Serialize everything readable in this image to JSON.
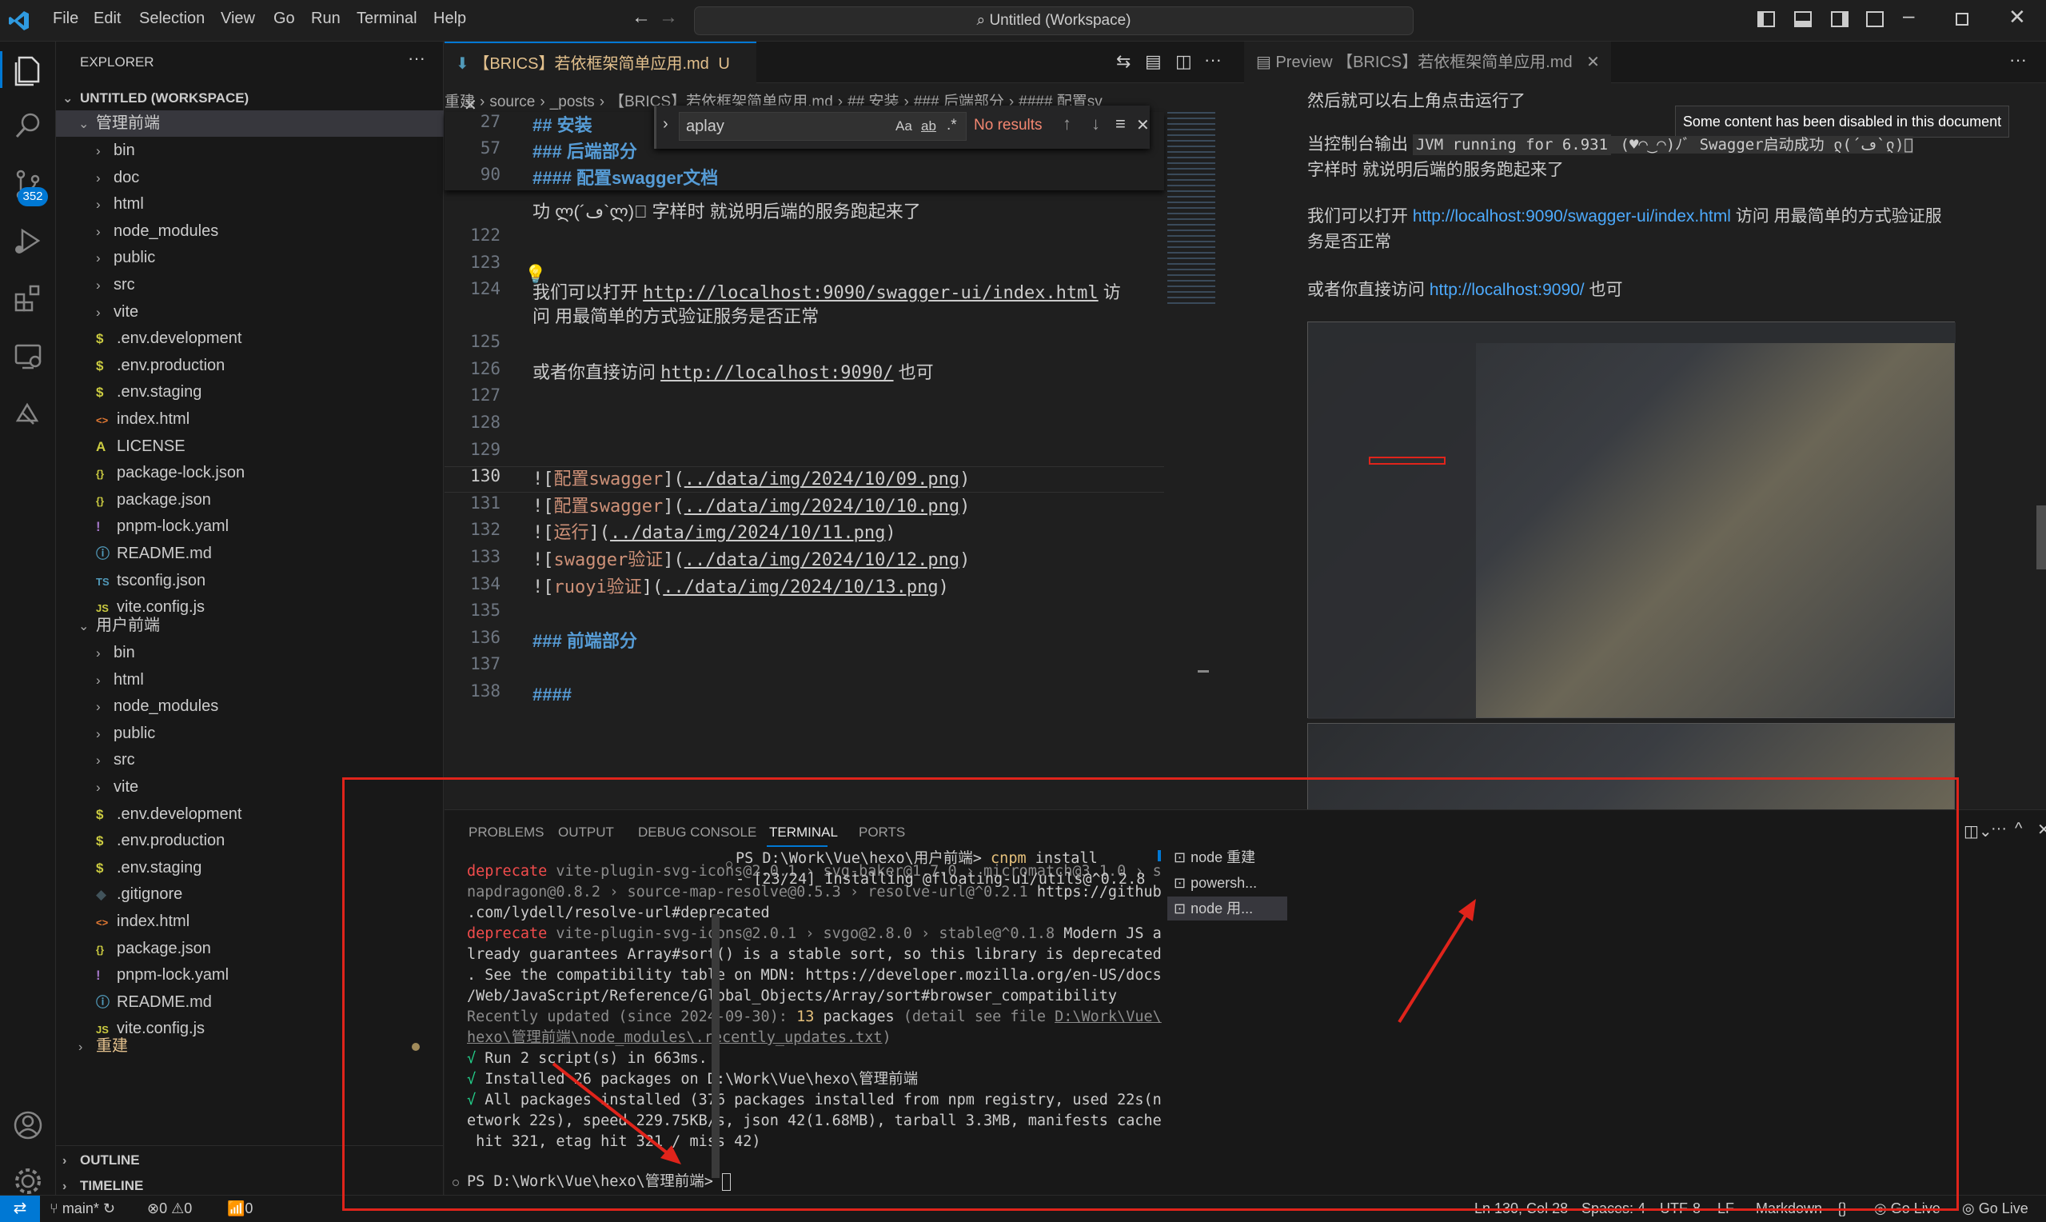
{
  "window": {
    "title": "Untitled (Workspace)",
    "menu": [
      "File",
      "Edit",
      "Selection",
      "View",
      "Go",
      "Run",
      "Terminal",
      "Help"
    ]
  },
  "activity": {
    "scm_badge": "352"
  },
  "explorer": {
    "header": "EXPLORER",
    "workspace": "UNTITLED (WORKSPACE)",
    "folder1": {
      "name": "管理前端",
      "items": [
        {
          "label": "bin",
          "kind": "folder"
        },
        {
          "label": "doc",
          "kind": "folder"
        },
        {
          "label": "html",
          "kind": "folder"
        },
        {
          "label": "node_modules",
          "kind": "folder"
        },
        {
          "label": "public",
          "kind": "folder"
        },
        {
          "label": "src",
          "kind": "folder"
        },
        {
          "label": "vite",
          "kind": "folder"
        },
        {
          "label": ".env.development",
          "kind": "env"
        },
        {
          "label": ".env.production",
          "kind": "env"
        },
        {
          "label": ".env.staging",
          "kind": "env"
        },
        {
          "label": "index.html",
          "kind": "html"
        },
        {
          "label": "LICENSE",
          "kind": "license"
        },
        {
          "label": "package-lock.json",
          "kind": "json"
        },
        {
          "label": "package.json",
          "kind": "json"
        },
        {
          "label": "pnpm-lock.yaml",
          "kind": "yaml"
        },
        {
          "label": "README.md",
          "kind": "info"
        },
        {
          "label": "tsconfig.json",
          "kind": "ts"
        },
        {
          "label": "vite.config.js",
          "kind": "js"
        }
      ]
    },
    "folder2": {
      "name": "用户前端",
      "items": [
        {
          "label": "bin",
          "kind": "folder"
        },
        {
          "label": "html",
          "kind": "folder"
        },
        {
          "label": "node_modules",
          "kind": "folder"
        },
        {
          "label": "public",
          "kind": "folder"
        },
        {
          "label": "src",
          "kind": "folder"
        },
        {
          "label": "vite",
          "kind": "folder"
        },
        {
          "label": ".env.development",
          "kind": "env"
        },
        {
          "label": ".env.production",
          "kind": "env"
        },
        {
          "label": ".env.staging",
          "kind": "env"
        },
        {
          "label": ".gitignore",
          "kind": "git"
        },
        {
          "label": "index.html",
          "kind": "html"
        },
        {
          "label": "package.json",
          "kind": "json"
        },
        {
          "label": "pnpm-lock.yaml",
          "kind": "yaml"
        },
        {
          "label": "README.md",
          "kind": "info"
        },
        {
          "label": "vite.config.js",
          "kind": "js"
        }
      ]
    },
    "folder3": {
      "name": "重建"
    },
    "outline": "OUTLINE",
    "timeline": "TIMELINE"
  },
  "editor": {
    "tab_label": "【BRICS】若依框架简单应用.md",
    "tab_status": "U",
    "breadcrumb": [
      "重建",
      "source",
      "_posts",
      "【BRICS】若依框架简单应用.md",
      "## 安装",
      "### 后端部分",
      "#### 配置sv"
    ],
    "find": {
      "query": "aplay",
      "result": "No results",
      "aa": "Aa",
      "ab": "ab",
      "regex": ".*"
    },
    "sticky": [
      {
        "num": "27",
        "text": "## 安装"
      },
      {
        "num": "57",
        "text": "### 后端部分"
      },
      {
        "num": "90",
        "text": "#### 配置swagger文档"
      }
    ],
    "partial_line": "功   ლ(´ڡ`ლ)゙  字样时 就说明后端的服务跑起来了",
    "lines": [
      {
        "num": "122",
        "text": ""
      },
      {
        "num": "123",
        "text": ""
      },
      {
        "num": "124",
        "text": "我们可以打开 ",
        "link": "http://localhost:9090/swagger-ui/index.html",
        "after": " 访"
      },
      {
        "num": "",
        "text": "问 用最简单的方式验证服务是否正常"
      },
      {
        "num": "125",
        "text": ""
      },
      {
        "num": "126",
        "text": "或者你直接访问 ",
        "link": "http://localhost:9090/",
        "after": " 也可"
      },
      {
        "num": "127",
        "text": ""
      },
      {
        "num": "128",
        "text": ""
      },
      {
        "num": "129",
        "text": ""
      },
      {
        "num": "130",
        "alt": "配置swagger",
        "url": "../data/img/2024/10/09.png"
      },
      {
        "num": "131",
        "alt": "配置swagger",
        "url": "../data/img/2024/10/10.png"
      },
      {
        "num": "132",
        "alt": "运行",
        "url": "../data/img/2024/10/11.png"
      },
      {
        "num": "133",
        "alt": "swagger验证",
        "url": "../data/img/2024/10/12.png"
      },
      {
        "num": "134",
        "alt": "ruoyi验证",
        "url": "../data/img/2024/10/13.png"
      },
      {
        "num": "135",
        "text": ""
      },
      {
        "num": "136",
        "heading": "### 前端部分"
      },
      {
        "num": "137",
        "text": ""
      },
      {
        "num": "138",
        "heading": "####"
      }
    ]
  },
  "preview": {
    "tab_label": "Preview 【BRICS】若依框架简单应用.md",
    "notice": "Some content has been disabled in this document",
    "p1": "然后就可以右上角点击运行了",
    "p2a": "当控制台输出 ",
    "p2code": "JVM running for 6.931",
    "p2b": " (♥◠‿◠)ﾉﾞ  Swagger启动成功   ლ(´ڡ`ლ)゙",
    "p2c": "字样时 就说明后端的服务跑起来了",
    "p3a": "我们可以打开 ",
    "p3link": "http://localhost:9090/swagger-ui/index.html",
    "p3b": " 访问 用最简单的方式验证服",
    "p3c": "务是否正常",
    "p4a": "或者你直接访问 ",
    "p4link": "http://localhost:9090/",
    "p4b": " 也可"
  },
  "panel": {
    "tabs": [
      "PROBLEMS",
      "OUTPUT",
      "DEBUG CONSOLE",
      "TERMINAL",
      "PORTS"
    ],
    "terminal_left": [
      {
        "parts": [
          {
            "t": "deprecate",
            "c": "red"
          },
          {
            "t": " vite-plugin-svg-icons@2.0.1 › svg-baker@1.7.0 › micromatch@3.1.0 › s",
            "c": "gray"
          }
        ]
      },
      {
        "parts": [
          {
            "t": "napdragon@0.8.2 › source-map-resolve@0.5.3 › resolve-url@^0.2.1 ",
            "c": "gray"
          },
          {
            "t": "https://github",
            "c": ""
          }
        ]
      },
      {
        "parts": [
          {
            "t": ".com/lydell/resolve-url#deprecated",
            "c": ""
          }
        ]
      },
      {
        "parts": [
          {
            "t": "deprecate",
            "c": "red"
          },
          {
            "t": " vite-plugin-svg-icons@2.0.1 › svgo@2.8.0 › stable@^0.1.8 ",
            "c": "gray"
          },
          {
            "t": "Modern JS a",
            "c": ""
          }
        ]
      },
      {
        "parts": [
          {
            "t": "lready guarantees Array#sort() is a stable sort, so this library is deprecated",
            "c": ""
          }
        ]
      },
      {
        "parts": [
          {
            "t": ". See the compatibility table on MDN: https://developer.mozilla.org/en-US/docs",
            "c": ""
          }
        ]
      },
      {
        "parts": [
          {
            "t": "/Web/JavaScript/Reference/Global_Objects/Array/sort#browser_compatibility",
            "c": ""
          }
        ]
      },
      {
        "parts": [
          {
            "t": "Recently updated (since 2024-09-30): ",
            "c": "gray"
          },
          {
            "t": "13",
            "c": "yellow"
          },
          {
            "t": " packages",
            "c": ""
          },
          {
            "t": " (detail see file ",
            "c": "gray"
          },
          {
            "t": "D:\\Work\\Vue\\",
            "c": "gray under"
          }
        ]
      },
      {
        "parts": [
          {
            "t": "hexo\\管理前端\\node_modules\\.recently_updates.txt",
            "c": "gray under"
          },
          {
            "t": ")",
            "c": "gray"
          }
        ]
      },
      {
        "parts": [
          {
            "t": "√ ",
            "c": "green"
          },
          {
            "t": "Run 2 script(s) in 663ms.",
            "c": ""
          }
        ]
      },
      {
        "parts": [
          {
            "t": "√ ",
            "c": "green"
          },
          {
            "t": "Installed 26 packages on D:\\Work\\Vue\\hexo\\管理前端",
            "c": ""
          }
        ]
      },
      {
        "parts": [
          {
            "t": "√ ",
            "c": "green"
          },
          {
            "t": "All packages installed (376 packages installed from npm registry, used 22s(n",
            "c": ""
          }
        ]
      },
      {
        "parts": [
          {
            "t": "etwork 22s), speed 229.75KB/s, json 42(1.68MB), tarball 3.3MB, manifests cache",
            "c": ""
          }
        ]
      },
      {
        "parts": [
          {
            "t": " hit 321, etag hit 321 / miss 42)",
            "c": ""
          }
        ]
      }
    ],
    "prompt_left": "PS D:\\Work\\Vue\\hexo\\管理前端> ",
    "prompt_right": "PS D:\\Work\\Vue\\hexo\\用户前端> ",
    "cmd_right": "cnpm",
    "cmd_right_arg": " install",
    "right_line2": "- [23/24] Installing @floating-ui/utils@^0.2.8",
    "terminals": [
      "node 重建",
      "powersh...",
      "node 用..."
    ]
  },
  "status": {
    "branch": "main*",
    "errors": "0",
    "warnings": "0",
    "ports": "0",
    "cursor": "Ln 130, Col 28",
    "spaces": "Spaces: 4",
    "encoding": "UTF-8",
    "eol": "LF",
    "language": "Markdown",
    "golive1": "Go Live",
    "golive2": "Go Live"
  },
  "colors": {
    "accent": "#0078d4",
    "annotation_red": "#e0241b",
    "heading": "#569cd6",
    "link": "#4daafc"
  }
}
